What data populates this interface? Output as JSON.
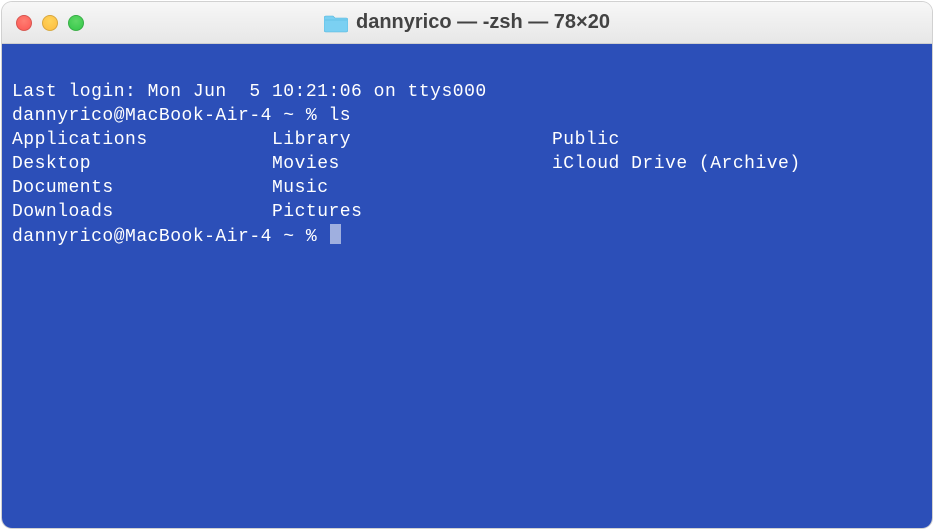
{
  "titlebar": {
    "window_title": "dannyrico — -zsh — 78×20"
  },
  "terminal": {
    "last_login": "Last login: Mon Jun  5 10:21:06 on ttys000",
    "prompt1_userhost": "dannyrico@MacBook-Air-4 ~ % ",
    "command1": "ls",
    "ls_output": [
      [
        "Applications",
        "Library",
        "Public"
      ],
      [
        "Desktop",
        "Movies",
        "iCloud Drive (Archive)"
      ],
      [
        "Documents",
        "Music",
        ""
      ],
      [
        "Downloads",
        "Pictures",
        ""
      ]
    ],
    "prompt2_userhost": "dannyrico@MacBook-Air-4 ~ % "
  }
}
